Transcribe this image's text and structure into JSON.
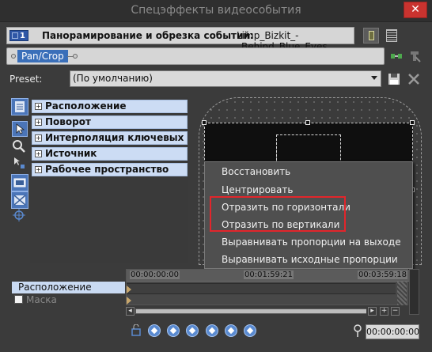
{
  "window": {
    "title": "Спецэффекты видеособытия",
    "close_glyph": "✕"
  },
  "header": {
    "track_number": "1",
    "title": "Панорамирование и обрезка событий:",
    "filename": "Limp_Bizkit_-_Behind_Blue_Eyes"
  },
  "effect_chain": {
    "item_label": "Pan/Crop"
  },
  "preset": {
    "label": "Preset:",
    "value": "(По умолчанию)"
  },
  "properties": [
    {
      "label": "Расположение"
    },
    {
      "label": "Поворот"
    },
    {
      "label": "Интерполяция ключевых ка..."
    },
    {
      "label": "Источник"
    },
    {
      "label": "Рабочее пространство"
    }
  ],
  "context_menu": {
    "items": [
      {
        "label": "Восстановить"
      },
      {
        "label": "Центрировать"
      },
      {
        "label": "Отразить по горизонтали"
      },
      {
        "label": "Отразить по вертикали"
      },
      {
        "label": "Выравнивать пропорции на выходе"
      },
      {
        "label": "Выравнивать исходные пропорции"
      }
    ]
  },
  "timeline": {
    "tracks": [
      {
        "label": "Расположение"
      },
      {
        "label": "Маска"
      }
    ],
    "timecodes": [
      "00:00:00:00",
      "00:01:59:21",
      "00:03:59:18"
    ],
    "current_time": "00:00:00:00"
  },
  "colors": {
    "accent": "#4b75b8",
    "highlight_border": "#e2252b"
  }
}
